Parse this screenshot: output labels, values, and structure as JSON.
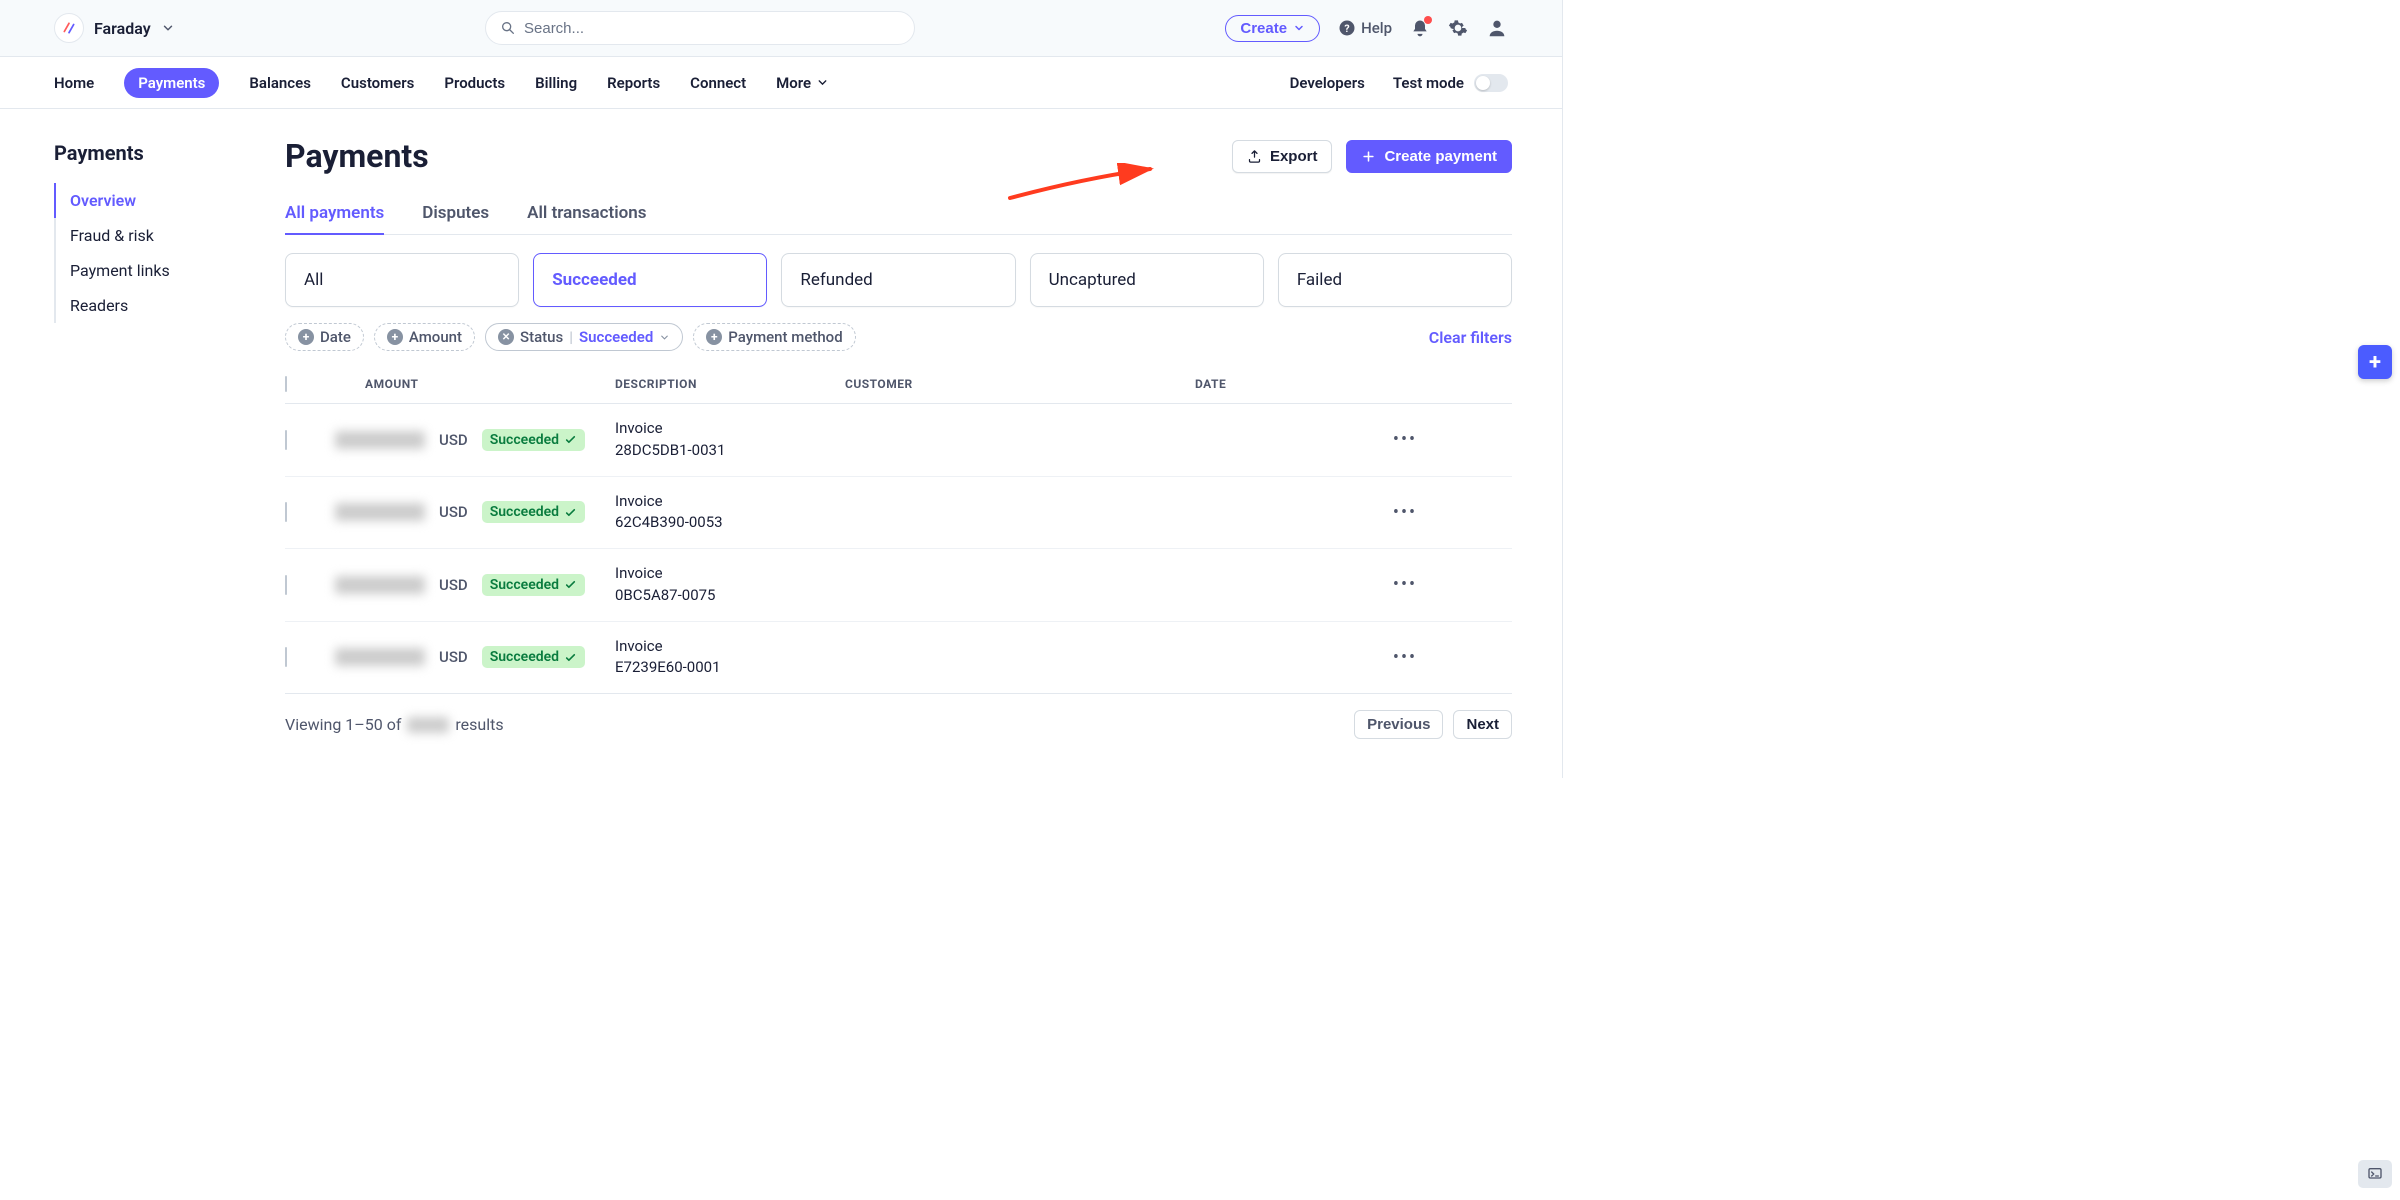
{
  "brand": {
    "name": "Faraday"
  },
  "search": {
    "placeholder": "Search..."
  },
  "topbar": {
    "create": "Create",
    "help": "Help"
  },
  "nav": {
    "items": [
      "Home",
      "Payments",
      "Balances",
      "Customers",
      "Products",
      "Billing",
      "Reports",
      "Connect",
      "More"
    ],
    "active_index": 1,
    "developers": "Developers",
    "test_mode": "Test mode"
  },
  "sidebar": {
    "title": "Payments",
    "items": [
      "Overview",
      "Fraud & risk",
      "Payment links",
      "Readers"
    ],
    "active_index": 0
  },
  "page": {
    "title": "Payments"
  },
  "actions": {
    "export": "Export",
    "create_payment": "Create payment"
  },
  "tabs": {
    "items": [
      "All payments",
      "Disputes",
      "All transactions"
    ],
    "active_index": 0
  },
  "filter_cards": {
    "items": [
      "All",
      "Succeeded",
      "Refunded",
      "Uncaptured",
      "Failed"
    ],
    "active_index": 1
  },
  "filters": {
    "date": "Date",
    "amount": "Amount",
    "status_label": "Status",
    "status_value": "Succeeded",
    "payment_method": "Payment method",
    "clear": "Clear filters"
  },
  "table": {
    "headers": {
      "amount": "AMOUNT",
      "description": "DESCRIPTION",
      "customer": "CUSTOMER",
      "date": "DATE"
    },
    "currency": "USD",
    "status": "Succeeded",
    "rows": [
      {
        "description": "Invoice 28DC5DB1-0031"
      },
      {
        "description": "Invoice 62C4B390-0053"
      },
      {
        "description": "Invoice 0BC5A87-0075"
      },
      {
        "description": "Invoice E7239E60-0001"
      }
    ]
  },
  "footer": {
    "viewing_prefix": "Viewing 1–50 of",
    "viewing_suffix": "results",
    "previous": "Previous",
    "next": "Next"
  }
}
